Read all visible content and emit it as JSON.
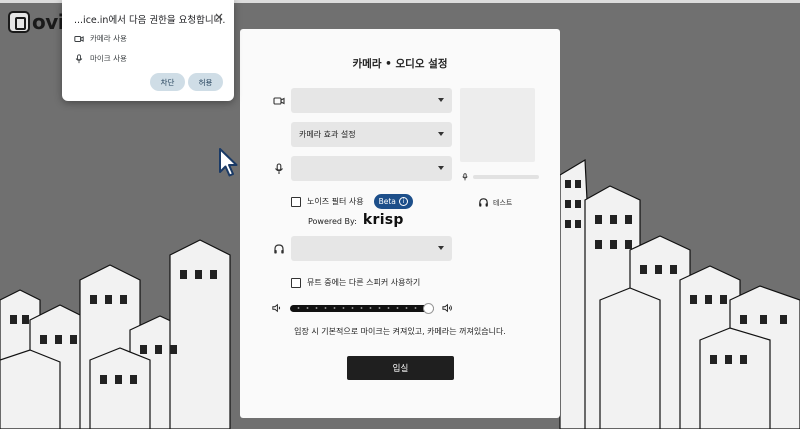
{
  "app": {
    "logo_text": "ovic"
  },
  "permission_popup": {
    "title": "...ice.in에서 다음 권한을 요청합니다.",
    "close": "×",
    "items": [
      {
        "icon": "camera-icon",
        "label": "카메라 사용"
      },
      {
        "icon": "microphone-icon",
        "label": "마이크 사용"
      }
    ],
    "block_label": "차단",
    "allow_label": "허용"
  },
  "modal": {
    "title": "카메라 • 오디오 설정",
    "camera_select": {
      "value": ""
    },
    "camera_effect_select": {
      "value": "카메라 효과 설정"
    },
    "mic_select": {
      "value": ""
    },
    "noise_filter": {
      "label": "노이즈 필터 사용",
      "checked": false,
      "badge": "Beta",
      "badge_icon": "i"
    },
    "powered_by": {
      "label": "Powered By:",
      "brand": "krisp"
    },
    "speaker_select": {
      "value": ""
    },
    "mute_speaker": {
      "label": "뮤트 중에는 다른 스피커 사용하기",
      "checked": false
    },
    "volume": {
      "level": 1.0
    },
    "test_label": "테스트",
    "info_text": "입장 시 기본적으로 마이크는 켜져있고, 카메라는 꺼져있습니다.",
    "enter_label": "입실"
  },
  "colors": {
    "badge": "#1d4f8a",
    "enter_button": "#1f1f1f",
    "permission_button": "#cfdde6"
  }
}
